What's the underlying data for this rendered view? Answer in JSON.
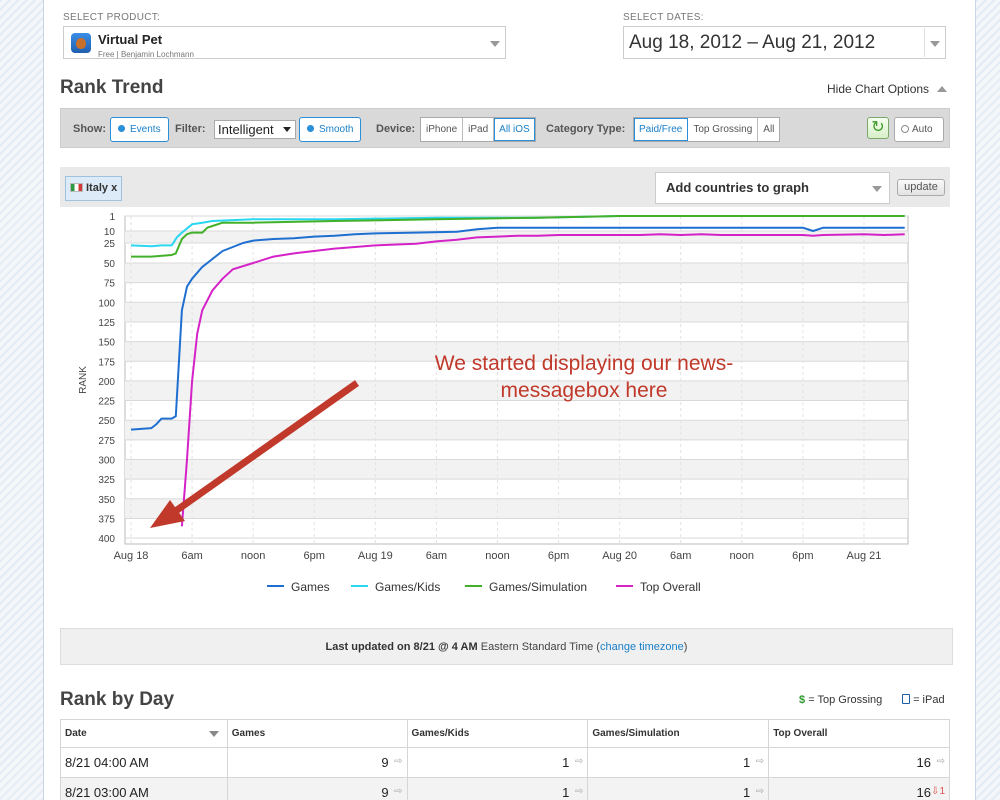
{
  "product": {
    "label": "SELECT PRODUCT:",
    "name": "Virtual Pet",
    "sub": "Free | Benjamin Lochmann"
  },
  "dates": {
    "label": "SELECT DATES:",
    "value": "Aug 18, 2012 – Aug 21, 2012"
  },
  "rank_trend": {
    "title": "Rank Trend",
    "hide_options": "Hide Chart Options"
  },
  "options": {
    "show_label": "Show:",
    "events": "Events",
    "filter_label": "Filter:",
    "filter_value": "Intelligent",
    "smooth": "Smooth",
    "device_label": "Device:",
    "devices": [
      "iPhone",
      "iPad",
      "All iOS"
    ],
    "device_selected": "All iOS",
    "category_label": "Category Type:",
    "categories": [
      "Paid/Free",
      "Top Grossing",
      "All"
    ],
    "category_selected": "Paid/Free",
    "auto": "Auto"
  },
  "countries": {
    "tag": "Italy x",
    "add_placeholder": "Add countries to graph",
    "update": "update"
  },
  "annotation": "We started displaying our news-messagebox here",
  "chart_data": {
    "type": "line",
    "ylabel": "RANK",
    "y_inverted": true,
    "ylim": [
      1,
      400
    ],
    "yticks": [
      1,
      10,
      25,
      50,
      75,
      100,
      125,
      150,
      175,
      200,
      225,
      250,
      275,
      300,
      325,
      350,
      375,
      400
    ],
    "x_range_hours": [
      0,
      78
    ],
    "xticks": [
      {
        "t": 0,
        "label": "Aug 18"
      },
      {
        "t": 6,
        "label": "6am"
      },
      {
        "t": 12,
        "label": "noon"
      },
      {
        "t": 18,
        "label": "6pm"
      },
      {
        "t": 24,
        "label": "Aug 19"
      },
      {
        "t": 30,
        "label": "6am"
      },
      {
        "t": 36,
        "label": "noon"
      },
      {
        "t": 42,
        "label": "6pm"
      },
      {
        "t": 48,
        "label": "Aug 20"
      },
      {
        "t": 54,
        "label": "6am"
      },
      {
        "t": 60,
        "label": "noon"
      },
      {
        "t": 66,
        "label": "6pm"
      },
      {
        "t": 72,
        "label": "Aug 21"
      }
    ],
    "grid": true,
    "legend_position": "bottom",
    "series": [
      {
        "name": "Games",
        "color": "#1f6fd1",
        "points": [
          [
            0,
            262
          ],
          [
            2,
            260
          ],
          [
            2.5,
            255
          ],
          [
            3,
            248
          ],
          [
            4,
            248
          ],
          [
            4.4,
            245
          ],
          [
            5,
            110
          ],
          [
            5.5,
            80
          ],
          [
            6,
            70
          ],
          [
            7,
            55
          ],
          [
            8,
            45
          ],
          [
            9,
            35
          ],
          [
            10,
            30
          ],
          [
            11,
            25
          ],
          [
            12,
            22
          ],
          [
            14,
            20
          ],
          [
            16,
            19
          ],
          [
            18,
            17
          ],
          [
            20,
            16
          ],
          [
            22,
            14
          ],
          [
            24,
            13
          ],
          [
            28,
            12
          ],
          [
            32,
            11
          ],
          [
            34,
            9
          ],
          [
            36,
            8
          ],
          [
            40,
            8
          ],
          [
            48,
            8
          ],
          [
            60,
            8
          ],
          [
            66,
            8
          ],
          [
            67,
            10
          ],
          [
            68,
            8
          ],
          [
            76,
            8
          ]
        ]
      },
      {
        "name": "Games/Kids",
        "color": "#2bd6f0",
        "points": [
          [
            0,
            28
          ],
          [
            2,
            29
          ],
          [
            3,
            28
          ],
          [
            4,
            28
          ],
          [
            4.5,
            18
          ],
          [
            5,
            12
          ],
          [
            6,
            6
          ],
          [
            7,
            5
          ],
          [
            8,
            4
          ],
          [
            12,
            3
          ],
          [
            20,
            3
          ],
          [
            30,
            2
          ],
          [
            40,
            2
          ],
          [
            48,
            1
          ],
          [
            60,
            1
          ],
          [
            76,
            1
          ]
        ]
      },
      {
        "name": "Games/Simulation",
        "color": "#43b02a",
        "points": [
          [
            0,
            42
          ],
          [
            2,
            42
          ],
          [
            4,
            40
          ],
          [
            4.4,
            38
          ],
          [
            5,
            20
          ],
          [
            5.5,
            14
          ],
          [
            6,
            12
          ],
          [
            7,
            12
          ],
          [
            7.5,
            8
          ],
          [
            8,
            7
          ],
          [
            9,
            5
          ],
          [
            12,
            5
          ],
          [
            20,
            4
          ],
          [
            30,
            3
          ],
          [
            40,
            2
          ],
          [
            48,
            1
          ],
          [
            60,
            1
          ],
          [
            76,
            1
          ]
        ]
      },
      {
        "name": "Top Overall",
        "color": "#d422c8",
        "points": [
          [
            5,
            385
          ],
          [
            5.5,
            300
          ],
          [
            6,
            200
          ],
          [
            6.5,
            140
          ],
          [
            7,
            110
          ],
          [
            8,
            85
          ],
          [
            9,
            70
          ],
          [
            10,
            58
          ],
          [
            12,
            50
          ],
          [
            14,
            42
          ],
          [
            16,
            38
          ],
          [
            18,
            35
          ],
          [
            20,
            32
          ],
          [
            22,
            30
          ],
          [
            24,
            28
          ],
          [
            28,
            26
          ],
          [
            30,
            23
          ],
          [
            32,
            21
          ],
          [
            34,
            18
          ],
          [
            36,
            17
          ],
          [
            38,
            16
          ],
          [
            40,
            16
          ],
          [
            42,
            15
          ],
          [
            44,
            15
          ],
          [
            46,
            15
          ],
          [
            48,
            15
          ],
          [
            50,
            15
          ],
          [
            52,
            14
          ],
          [
            54,
            15
          ],
          [
            56,
            14
          ],
          [
            58,
            15
          ],
          [
            60,
            15
          ],
          [
            62,
            15
          ],
          [
            66,
            15
          ],
          [
            67,
            16
          ],
          [
            68,
            15
          ],
          [
            72,
            14
          ],
          [
            74,
            15
          ],
          [
            76,
            14
          ]
        ]
      }
    ]
  },
  "last_updated": {
    "label": "Last updated on 8/21 @ 4 AM",
    "tz": "Eastern Standard Time",
    "link": "change timezone"
  },
  "rank_by_day": {
    "title": "Rank by Day",
    "legend_grossing": "= Top Grossing",
    "legend_ipad": "= iPad",
    "columns": [
      "Date",
      "Games",
      "Games/Kids",
      "Games/Simulation",
      "Top Overall"
    ],
    "rows": [
      {
        "date": "8/21 04:00 AM",
        "values": [
          "9",
          "1",
          "1",
          "16"
        ],
        "changes": [
          "",
          "",
          "",
          ""
        ]
      },
      {
        "date": "8/21 03:00 AM",
        "values": [
          "9",
          "1",
          "1",
          "16"
        ],
        "changes": [
          "",
          "",
          "",
          "1"
        ]
      }
    ]
  }
}
